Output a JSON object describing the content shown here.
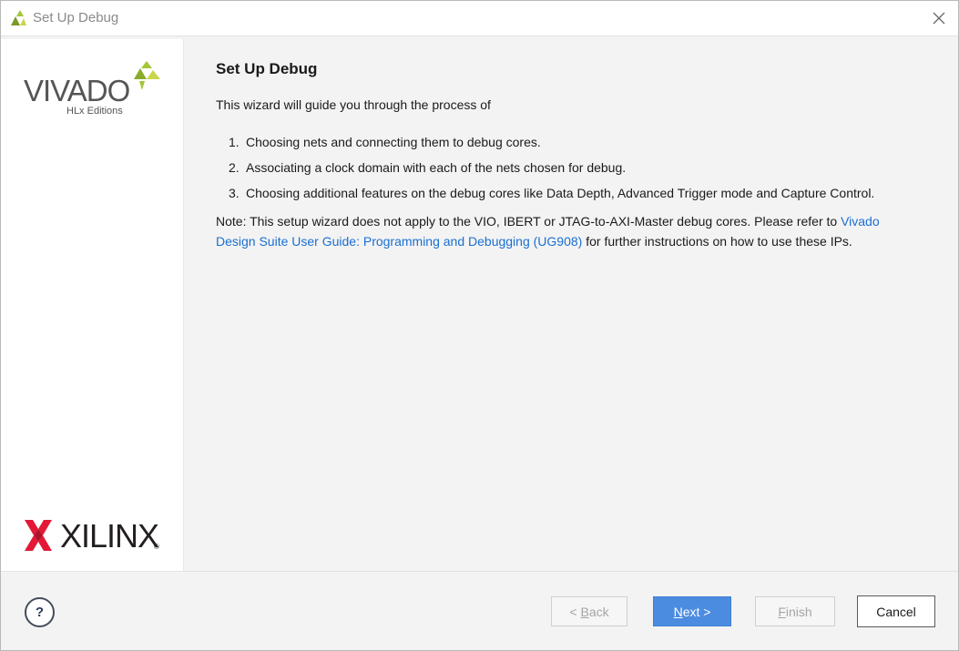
{
  "window": {
    "title": "Set Up Debug"
  },
  "sidebar": {
    "vivado_logo_text": "VIVADO",
    "vivado_edition_text": "HLx Editions",
    "xilinx_logo_text": "XILINX",
    "xilinx_reg_mark": "®"
  },
  "content": {
    "title": "Set Up Debug",
    "intro": "This wizard will guide you through the process of",
    "steps": [
      {
        "num": "1.",
        "text": "Choosing nets and connecting them to debug cores."
      },
      {
        "num": "2.",
        "text": "Associating a clock domain with each of the nets chosen for debug."
      },
      {
        "num": "3.",
        "text": "Choosing additional features on the debug cores like Data Depth, Advanced Trigger mode and Capture Control."
      }
    ],
    "note_prefix": "Note: This setup wizard does not apply to the VIO, IBERT or JTAG-to-AXI-Master debug cores. Please refer to ",
    "note_link": "Vivado Design Suite User Guide: Programming and Debugging (UG908)",
    "note_suffix": " for further instructions on how to use these IPs."
  },
  "footer": {
    "help_label": "?",
    "back_prefix": "< ",
    "back_mnemonic": "B",
    "back_rest": "ack",
    "next_mnemonic": "N",
    "next_rest": "ext >",
    "finish_mnemonic": "F",
    "finish_rest": "inish",
    "cancel_label": "Cancel"
  },
  "colors": {
    "link": "#1a6fd1",
    "primary_button": "#4c8ce0",
    "vivado_leaf": "#a4c639",
    "xilinx_red": "#e31837"
  },
  "icons": {
    "title_icon": "vivado-leaf-icon",
    "close_icon": "close-icon",
    "help_icon": "help-icon",
    "xilinx_icon": "xilinx-x-icon"
  }
}
